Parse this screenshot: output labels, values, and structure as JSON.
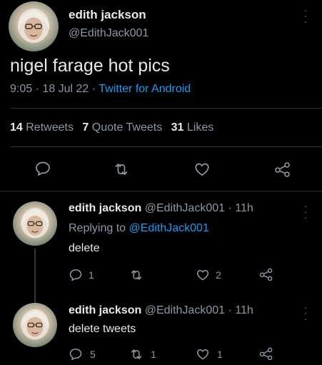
{
  "main_tweet": {
    "display_name": "edith jackson",
    "handle": "@EdithJack001",
    "text": "nigel farage hot pics",
    "time": "9:05",
    "sep1": "·",
    "date": "18 Jul 22",
    "sep2": "·",
    "source": "Twitter for Android",
    "stats": {
      "retweets_count": "14",
      "retweets_label": "Retweets",
      "quotes_count": "7",
      "quotes_label": "Quote Tweets",
      "likes_count": "31",
      "likes_label": "Likes"
    }
  },
  "replies": [
    {
      "display_name": "edith jackson",
      "handle_time": "@EdithJack001 · 11h",
      "replying_prefix": "Replying to",
      "replying_handle": "@EdithJack001",
      "text": "delete",
      "reply_count": "1",
      "retweet_count": "",
      "like_count": "2"
    },
    {
      "display_name": "edith jackson",
      "handle_time": "@EdithJack001 · 11h",
      "text": "delete tweets",
      "reply_count": "5",
      "retweet_count": "1",
      "like_count": "1"
    }
  ],
  "icons": {
    "more": "more-vertical-icon",
    "reply": "comment-icon",
    "retweet": "retweet-icon",
    "like": "heart-icon",
    "share": "share-icon"
  },
  "colors": {
    "background": "#000000",
    "text": "#e7e9ea",
    "muted": "#8b98a5",
    "link": "#1d9bf0",
    "divider": "#2f3336"
  }
}
